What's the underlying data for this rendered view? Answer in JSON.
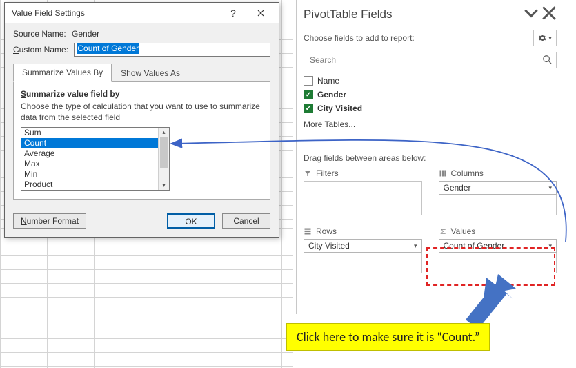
{
  "dialog": {
    "title": "Value Field Settings",
    "source_label": "Source Name:",
    "source_value": "Gender",
    "custom_label_prefix_underlined": "C",
    "custom_label_rest": "ustom Name:",
    "custom_name": "Count of Gender",
    "tabs": {
      "summarize": "Summarize Values By",
      "show_as": "Show Values As"
    },
    "section_title_prefix_underlined": "S",
    "section_title_rest": "ummarize value field by",
    "hint": "Choose the type of calculation that you want to use to summarize data from the selected field",
    "funcs": [
      "Sum",
      "Count",
      "Average",
      "Max",
      "Min",
      "Product"
    ],
    "selected_func_index": 1,
    "number_format_underlined": "N",
    "number_format_rest": "umber Format",
    "ok": "OK",
    "cancel": "Cancel"
  },
  "pane": {
    "title": "PivotTable Fields",
    "choose_label": "Choose fields to add to report:",
    "search_placeholder": "Search",
    "fields": [
      {
        "label": "Name",
        "checked": false,
        "bold": false
      },
      {
        "label": "Gender",
        "checked": true,
        "bold": true
      },
      {
        "label": "City Visited",
        "checked": true,
        "bold": true
      }
    ],
    "more_tables": "More Tables...",
    "drag_label": "Drag fields between areas below:",
    "filters_title": "Filters",
    "columns_title": "Columns",
    "rows_title": "Rows",
    "values_title": "Values",
    "columns_value": "Gender",
    "rows_value": "City Visited",
    "values_value": "Count of Gender"
  },
  "annotation": {
    "tip": "Click here to make sure it is “Count.”"
  }
}
